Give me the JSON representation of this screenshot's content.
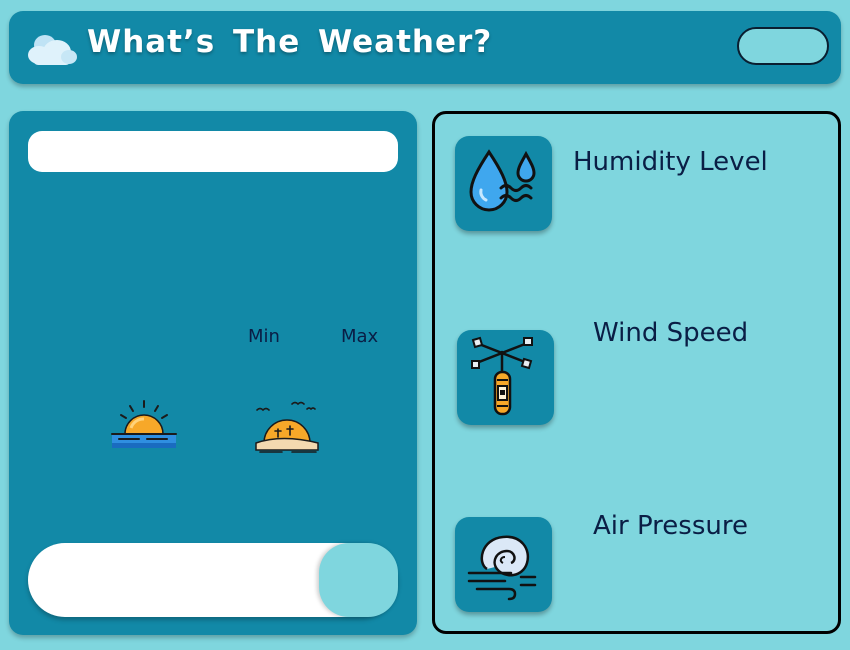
{
  "header": {
    "title": "What’s The Weather?",
    "logo_icon": "cloud-icon",
    "toggle_icon": "toggle-switch"
  },
  "weather_panel": {
    "location_input": {
      "value": "",
      "placeholder": ""
    },
    "min_label": "Min",
    "max_label": "Max",
    "sunrise_icon": "sunrise-icon",
    "sunset_icon": "sunset-icon",
    "search": {
      "value": "",
      "placeholder": "",
      "button_icon": "search-button"
    }
  },
  "metrics": [
    {
      "label": "Humidity Level",
      "icon": "humidity-icon"
    },
    {
      "label": "Wind Speed",
      "icon": "anemometer-icon"
    },
    {
      "label": "Air Pressure",
      "icon": "air-pressure-icon"
    }
  ],
  "colors": {
    "background": "#7fd6de",
    "panel": "#1289a7",
    "text_dark": "#0a1e45",
    "white": "#ffffff"
  }
}
